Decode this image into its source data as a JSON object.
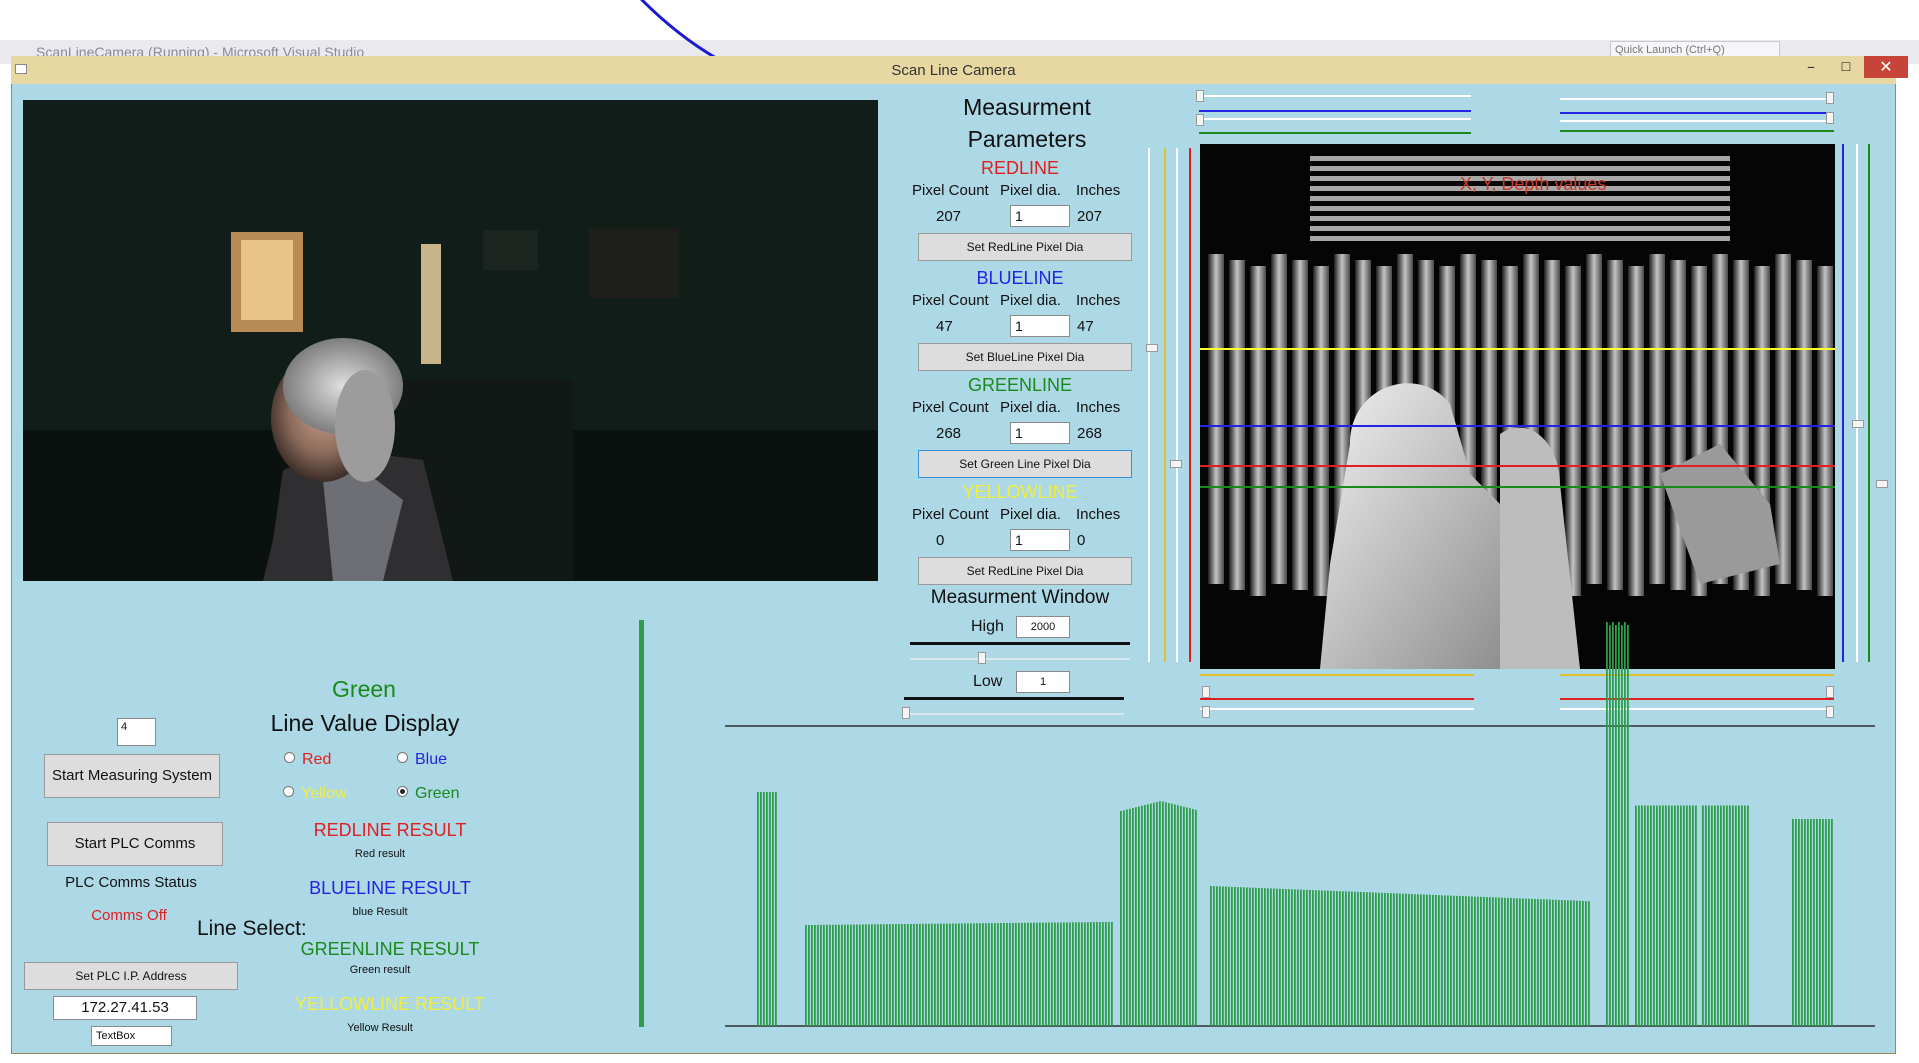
{
  "vs": {
    "title": "ScanLineCamera (Running) - Microsoft Visual Studio",
    "quick_launch": "Quick Launch (Ctrl+Q)"
  },
  "window": {
    "title": "Scan Line Camera",
    "minimize": "–",
    "maximize": "☐",
    "close": "✕"
  },
  "params": {
    "heading_line1": "Measurment",
    "heading_line2": "Parameters",
    "col_pixel_count": "Pixel Count",
    "col_pixel_dia": "Pixel dia.",
    "col_inches": "Inches",
    "lines": [
      {
        "name": "REDLINE",
        "color": "#e02020",
        "pixel_count": "207",
        "pixel_dia": "1",
        "inches": "207",
        "button": "Set RedLine Pixel Dia"
      },
      {
        "name": "BLUELINE",
        "color": "#2323e0",
        "pixel_count": "47",
        "pixel_dia": "1",
        "inches": "47",
        "button": "Set BlueLine Pixel Dia"
      },
      {
        "name": "GREENLINE",
        "color": "#1a8a1a",
        "pixel_count": "268",
        "pixel_dia": "1",
        "inches": "268",
        "button": "Set Green Line Pixel Dia"
      },
      {
        "name": "YELLOWLINE",
        "color": "#f2ee3c",
        "pixel_count": "0",
        "pixel_dia": "1",
        "inches": "0",
        "button": "Set RedLine Pixel Dia"
      }
    ],
    "window_heading": "Measurment Window",
    "high_label": "High",
    "high_value": "2000",
    "low_label": "Low",
    "low_value": "1"
  },
  "depth": {
    "overlay_text": "X, Y, Depth values"
  },
  "controls": {
    "small_box": "4",
    "start_measuring": "Start Measuring System",
    "start_plc": "Start PLC Comms",
    "plc_status_label": "PLC Comms Status",
    "comms_off": "Comms Off",
    "set_plc_ip": "Set PLC I.P. Address",
    "ip_address": "172.27.41.53",
    "textbox": "TextBox"
  },
  "display": {
    "selected_line": "Green",
    "heading": "Line Value Display",
    "line_select": "Line Select:",
    "radios": [
      {
        "label": "Red",
        "color": "#e02020",
        "checked": false
      },
      {
        "label": "Blue",
        "color": "#2323e0",
        "checked": false
      },
      {
        "label": "Yellow",
        "color": "#f2ee3c",
        "checked": false
      },
      {
        "label": "Green",
        "color": "#1a8a1a",
        "checked": true
      }
    ],
    "results": [
      {
        "heading": "REDLINE RESULT",
        "value": "Red result",
        "color": "#e02020"
      },
      {
        "heading": "BLUELINE RESULT",
        "value": "blue Result",
        "color": "#2323e0"
      },
      {
        "heading": "GREENLINE RESULT",
        "value": "Green result",
        "color": "#1a8a1a"
      },
      {
        "heading": "YELLOWLINE RESULT",
        "value": "Yellow Result",
        "color": "#f2ee3c"
      }
    ]
  },
  "colors": {
    "window_bg": "#add8e6",
    "titlebar": "#e7d8a2",
    "bar_green": "#2e9e4a"
  }
}
